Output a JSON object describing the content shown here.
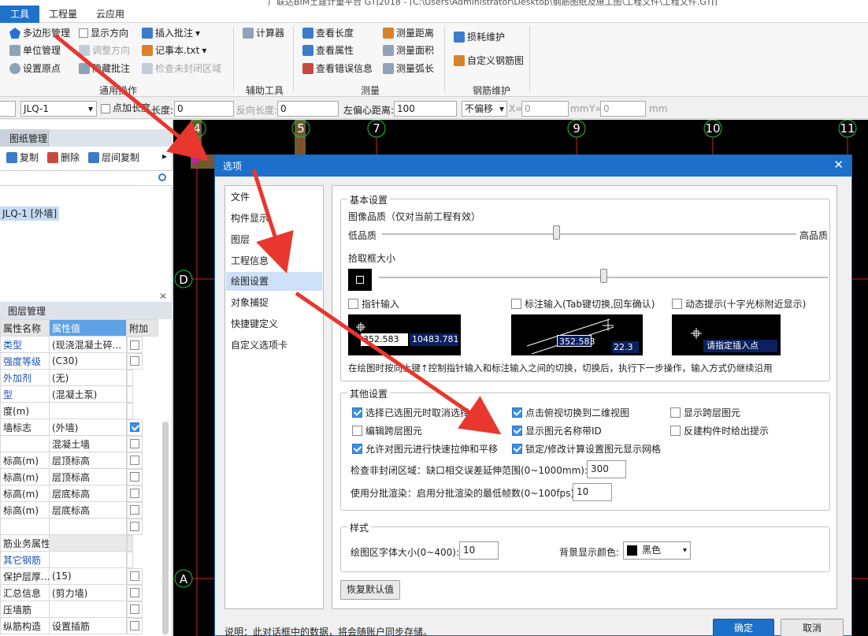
{
  "window": {
    "title_strip": "广联达BIM土建计量平台 GTJ2018 - [C:\\Users\\Administrator\\Desktop\\钢筋图纸及施工图\\工程文件\\工程文件.GTJ]"
  },
  "menu": {
    "tabs": [
      "工具",
      "工程量",
      "云应用"
    ]
  },
  "ribbon": {
    "general": {
      "polygon_mgmt": "多边形管理",
      "show_direction": "显示方向",
      "insert_note": "插入批注",
      "unit_mgmt": "单位管理",
      "adjust_direction": "调整方向",
      "notepad": "记事本.txt",
      "set_origin": "设置原点",
      "hide_note": "隐藏批注",
      "check_unclosed": "检查未封闭区域",
      "group_label": "通用操作"
    },
    "aux": {
      "calculator": "计算器",
      "group_label": "辅助工具"
    },
    "measure": {
      "view_length": "查看长度",
      "measure_distance": "测量距离",
      "view_attr": "查看属性",
      "measure_area": "测量面积",
      "view_errors": "查看错误信息",
      "measure_arc": "测量弧长",
      "group_label": "测量"
    },
    "rebar": {
      "loss_maint": "损耗维护",
      "custom_rebar": "自定义钢筋图",
      "group_label": "钢筋维护"
    }
  },
  "propbar": {
    "component": "JLQ-1",
    "point_length_label": "点加长度",
    "length_label": "长度:",
    "length_value": "0",
    "reverse_label": "反向长度:",
    "reverse_value": "0",
    "left_offset_label": "左偏心距离:",
    "left_offset_value": "100",
    "offset_mode": "不偏移",
    "x_label": "X=",
    "x_value": "0",
    "unit1": "mm",
    "y_label": "Y=",
    "y_value": "0",
    "unit2": "mm"
  },
  "left_top": {
    "tab": "图纸管理",
    "copy": "复制",
    "delete": "删除",
    "floor_copy": "层间复制",
    "selected_item": "JLQ-1 [外墙]"
  },
  "left_bottom": {
    "tab": "图层管理",
    "headers": [
      "属性名称",
      "属性值",
      "附加"
    ],
    "rows": [
      {
        "name": "类型",
        "value": "(现浇混凝土碎...",
        "blue": true,
        "check": "off"
      },
      {
        "name": "强度等级",
        "value": "(C30)",
        "blue": true,
        "check": "off"
      },
      {
        "name": "外加剂",
        "value": "(无)",
        "blue": true,
        "check": "none"
      },
      {
        "name": "型",
        "value": "(混凝土泵)",
        "blue": true,
        "check": "none"
      },
      {
        "name": "度(m)",
        "value": "",
        "blue": false,
        "check": "none"
      },
      {
        "name": "墙标志",
        "value": "(外墙)",
        "blue": false,
        "check": "on"
      },
      {
        "name": "",
        "value": "混凝土墙",
        "blue": false,
        "check": "off"
      },
      {
        "name": "标高(m)",
        "value": "层顶标高",
        "blue": false,
        "check": "off"
      },
      {
        "name": "标高(m)",
        "value": "层顶标高",
        "blue": false,
        "check": "off"
      },
      {
        "name": "标高(m)",
        "value": "层底标高",
        "blue": false,
        "check": "off"
      },
      {
        "name": "标高(m)",
        "value": "层底标高",
        "blue": false,
        "check": "off"
      },
      {
        "name": "",
        "value": "",
        "blue": false,
        "check": "off"
      },
      {
        "name": "筋业务属性",
        "value": "",
        "blue": false,
        "check": "group"
      },
      {
        "name": "其它钢筋",
        "value": "",
        "blue": true,
        "check": "none"
      },
      {
        "name": "保护层厚...",
        "value": "(15)",
        "blue": false,
        "check": "off"
      },
      {
        "name": "汇总信息",
        "value": "(剪力墙)",
        "blue": false,
        "check": "off"
      },
      {
        "name": "压墙筋",
        "value": "",
        "blue": false,
        "check": "off"
      },
      {
        "name": "纵筋构造",
        "value": "设置插筋",
        "blue": false,
        "check": "off"
      }
    ]
  },
  "canvas": {
    "axis_top": [
      "4",
      "5",
      "7",
      "9",
      "10",
      "11"
    ],
    "axis_left": [
      "D",
      "A"
    ]
  },
  "dialog": {
    "title": "选项",
    "nav": [
      "文件",
      "构件显示",
      "图层",
      "工程信息",
      "绘图设置",
      "对象捕捉",
      "快捷键定义",
      "自定义选项卡"
    ],
    "selected_nav": "绘图设置",
    "basic": {
      "legend": "基本设置",
      "quality_label": "图像品质（仅对当前工程有效）",
      "low": "低品质",
      "high": "高品质",
      "quality_value": 0.42,
      "pick_label": "拾取框大小",
      "pick_value": 0.5,
      "pointer_input": "指针输入",
      "dim_input": "标注输入(Tab键切换,回车确认)",
      "dyn_hint": "动态提示(十字光标附近显示)",
      "prev1_a": "352.583",
      "prev1_b": "10483.781",
      "prev2_a": "352.583",
      "prev2_b": "22.3",
      "prev3": "请指定插入点",
      "hint": "在绘图时按向上键↑控制指针输入和标注输入之间的切换，切换后，执行下一步操作，输入方式仍继续沿用"
    },
    "other": {
      "legend": "其他设置",
      "c1": "选择已选图元时取消选择",
      "c2": "点击俯视切换到二维视图",
      "c3": "显示跨层图元",
      "c4": "编辑跨层图元",
      "c5": "显示图元名称带ID",
      "c6": "反建构件时给出提示",
      "c7": "允许对图元进行快速拉伸和平移",
      "c8": "锁定/修改计算设置图元显示网格",
      "gap_label": "检查非封闭区域：缺口相交误差延伸范围(0~1000mm):",
      "gap_value": "300",
      "batch_label": "使用分批渲染：启用分批渲染的最低帧数(0~100fps):",
      "batch_value": "10"
    },
    "style": {
      "legend": "样式",
      "font_label": "绘图区字体大小(0~400):",
      "font_value": "10",
      "bg_label": "背景显示颜色:",
      "bg_value": "黑色"
    },
    "restore": "恢复默认值",
    "help": "说明：此对话框中的数据，将会随账户同步存储。",
    "ok": "确定",
    "cancel": "取消"
  },
  "colors": {
    "accent": "#1d70c9",
    "arrow": "#e8372e",
    "axis_line": "#d42020",
    "axis_circle": "#22c04a"
  }
}
